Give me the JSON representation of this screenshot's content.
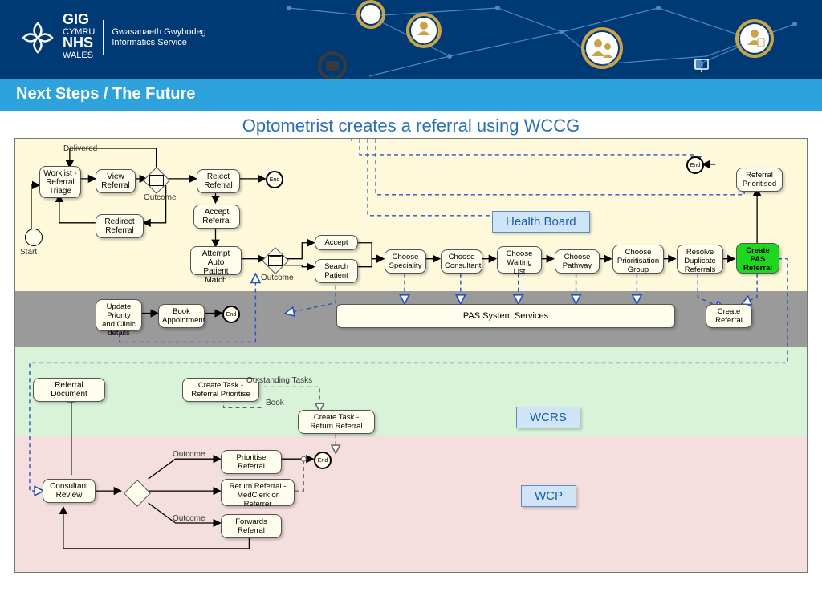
{
  "header": {
    "org1": "GIG",
    "org1_sub": "CYMRU",
    "org2": "NHS",
    "org2_sub": "WALES",
    "service_cy": "Gwasanaeth Gwybodeg",
    "service_en": "Informatics Service"
  },
  "titlebar": "Next Steps / The Future",
  "diagram_title": "Optometrist creates a referral using WCCG",
  "labels": {
    "delivered": "Delivered",
    "outcome": "Outcome",
    "start": "Start",
    "end": "End",
    "outstanding": "Outstanding Tasks",
    "book": "Book"
  },
  "nodes": {
    "worklist": "Worklist - Referral Triage",
    "view": "View Referral",
    "redirect": "Redirect Referral",
    "reject": "Reject Referral",
    "accept_ref": "Accept Referral",
    "attempt": "Attempt Auto Patient Match",
    "accept": "Accept",
    "search": "Search Patient",
    "speciality": "Choose Speciality",
    "consultant": "Choose Consultant",
    "waiting": "Choose Waiting List",
    "pathway": "Choose Pathway",
    "priorgrp": "Choose Prioritisation Group",
    "resolve": "Resolve Duplicate Referrals",
    "createpas": "Create PAS Referral",
    "refprior": "Referral Prioritised",
    "update": "Update Priority and Clinic details",
    "bookappt": "Book Appointment",
    "pas": "PAS System Services",
    "createref": "Create Referral",
    "refdoc": "Referral Document",
    "task_prior": "Create Task - Referral Prioritise",
    "task_return": "Create Task - Return Referral",
    "consrev": "Consultant Review",
    "priorref": "Prioritise Referral",
    "returnref": "Return Referral - MedClerk or Referrer",
    "forwards": "Forwards Referral"
  },
  "badges": {
    "hb": "Health Board",
    "wcrs": "WCRS",
    "wcp": "WCP"
  }
}
